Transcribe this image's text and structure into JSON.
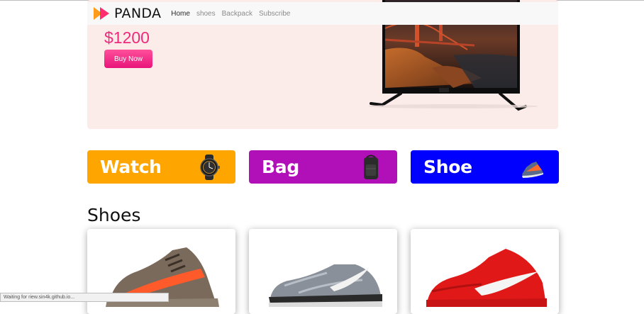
{
  "brand": {
    "name": "PANDA",
    "icon": "panda-play-logo-icon"
  },
  "nav": {
    "items": [
      {
        "label": "Home",
        "active": true
      },
      {
        "label": "shoes",
        "active": false
      },
      {
        "label": "Backpack",
        "active": false
      },
      {
        "label": "Subscribe",
        "active": false
      }
    ]
  },
  "hero": {
    "price": "$1200",
    "button_label": "Buy Now",
    "image": "television-icon"
  },
  "categories": [
    {
      "label": "Watch",
      "color": "#ffa500",
      "icon": "watch-icon"
    },
    {
      "label": "Bag",
      "color": "#b10fb8",
      "icon": "backpack-icon"
    },
    {
      "label": "Shoe",
      "color": "#0000ff",
      "icon": "sneaker-icon"
    }
  ],
  "shoes_section": {
    "title": "Shoes",
    "cards": [
      {
        "image": "grey-orange-sneaker-icon"
      },
      {
        "image": "grey-running-shoe-icon"
      },
      {
        "image": "red-sneaker-icon"
      }
    ]
  },
  "status_bar": {
    "text": "Waiting for riew.sin4k.github.io..."
  },
  "colors": {
    "accent": "#ee2a7b",
    "hero_bg": "#fbecea",
    "navbar_bg": "#f8f8f8"
  }
}
